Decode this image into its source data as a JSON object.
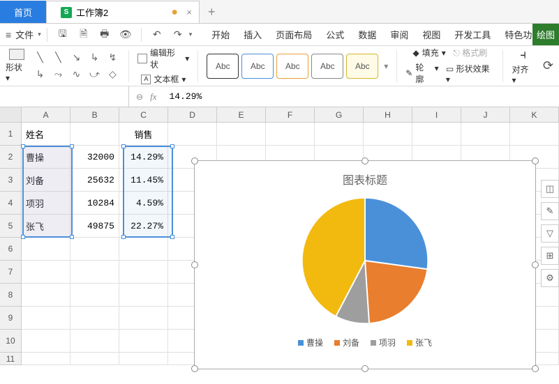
{
  "tabs": {
    "home": "首页",
    "doc_name": "工作簿2",
    "doc_icon": "S",
    "add": "+",
    "close": "×",
    "dirty": "●"
  },
  "menubar": {
    "file": "文件",
    "menus": [
      "开始",
      "插入",
      "页面布局",
      "公式",
      "数据",
      "审阅",
      "视图",
      "开发工具",
      "特色功能"
    ],
    "draw_tool": "绘图"
  },
  "ribbon": {
    "shapes_label": "形状",
    "edit_shape": "编辑形状",
    "text_box": "文本框",
    "style_label": "Abc",
    "fill": "填充",
    "outline": "轮廓",
    "effect": "形状效果",
    "format_painter": "格式刷",
    "align": "对齐"
  },
  "formula_bar": {
    "name": "",
    "value": "14.29%",
    "fx": "fx"
  },
  "columns": [
    "A",
    "B",
    "C",
    "D",
    "E",
    "F",
    "G",
    "H",
    "I",
    "J",
    "K"
  ],
  "rows_labels": [
    "1",
    "2",
    "3",
    "4",
    "5",
    "6",
    "7",
    "8",
    "9",
    "10",
    "11"
  ],
  "table": {
    "headers": {
      "a": "姓名",
      "c": "销售"
    },
    "rows": [
      {
        "name": "曹操",
        "value": "32000",
        "pct": "14.29%"
      },
      {
        "name": "刘备",
        "value": "25632",
        "pct": "11.45%"
      },
      {
        "name": "项羽",
        "value": "10284",
        "pct": "4.59%"
      },
      {
        "name": "张飞",
        "value": "49875",
        "pct": "22.27%"
      }
    ]
  },
  "chart_data": {
    "type": "pie",
    "title": "图表标题",
    "categories": [
      "曹操",
      "刘备",
      "项羽",
      "张飞"
    ],
    "values": [
      14.29,
      11.45,
      4.59,
      22.27
    ],
    "colors": [
      "#4a90d9",
      "#e87e2e",
      "#9e9e9e",
      "#f2b90f"
    ]
  }
}
